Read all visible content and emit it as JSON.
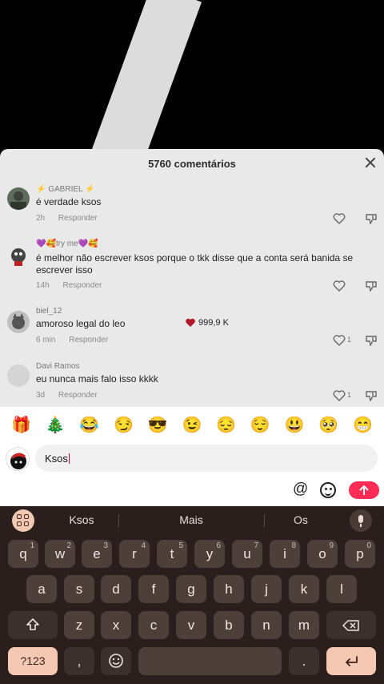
{
  "panel": {
    "title": "5760 comentários"
  },
  "comments": [
    {
      "user": "⚡ GABRIEL ⚡",
      "text": "é verdade ksos",
      "time": "2h",
      "reply": "Responder",
      "likes": ""
    },
    {
      "user": "💜🥰try me💜🥰",
      "text": "é melhor não escrever ksos porque o tkk disse que a conta será banida se escrever isso",
      "time": "14h",
      "reply": "Responder",
      "likes": ""
    },
    {
      "user": "biel_12",
      "text": "amoroso legal do leo",
      "time": "6 min",
      "reply": "Responder",
      "likes": "1"
    },
    {
      "user": "Davi Ramos",
      "text": "eu nunca mais falo isso kkkk",
      "time": "3d",
      "reply": "Responder",
      "likes": "1"
    }
  ],
  "overlay_likes": "999,9 K",
  "emoji_bar": [
    "🎁",
    "🎄",
    "😂",
    "😏",
    "😎",
    "😉",
    "😔",
    "😌",
    "😃",
    "🥺",
    "😁"
  ],
  "input": {
    "value": "Ksos"
  },
  "tools": {
    "mention": "@"
  },
  "keyboard": {
    "suggestions": [
      "Ksos",
      "Mais",
      "Os"
    ],
    "row1": [
      {
        "k": "q",
        "n": "1"
      },
      {
        "k": "w",
        "n": "2"
      },
      {
        "k": "e",
        "n": "3"
      },
      {
        "k": "r",
        "n": "4"
      },
      {
        "k": "t",
        "n": "5"
      },
      {
        "k": "y",
        "n": "6"
      },
      {
        "k": "u",
        "n": "7"
      },
      {
        "k": "i",
        "n": "8"
      },
      {
        "k": "o",
        "n": "9"
      },
      {
        "k": "p",
        "n": "0"
      }
    ],
    "row2": [
      "a",
      "s",
      "d",
      "f",
      "g",
      "h",
      "j",
      "k",
      "l"
    ],
    "row3": [
      "z",
      "x",
      "c",
      "v",
      "b",
      "n",
      "m"
    ],
    "symbols_label": "?123",
    "comma": ",",
    "period": "."
  },
  "colors": {
    "accent": "#fe2c55",
    "keyboard_bg": "#2a1f1c",
    "key_bg": "#4d3f3a",
    "key_accent": "#f4c8b3"
  }
}
